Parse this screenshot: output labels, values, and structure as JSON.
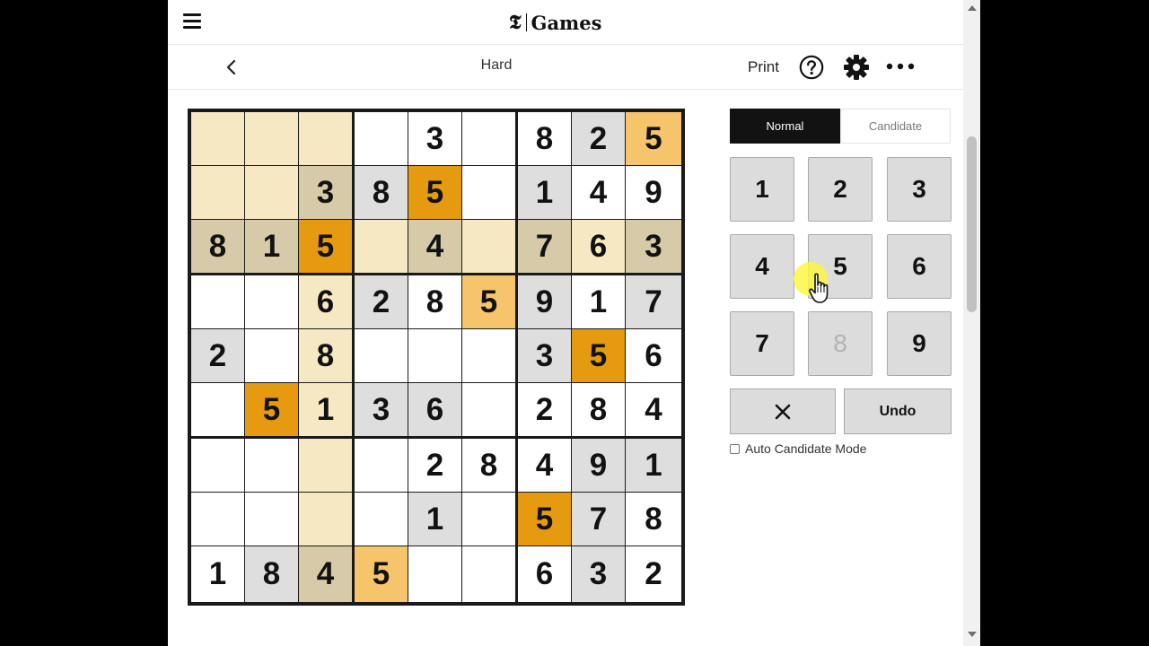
{
  "header": {
    "brand_mark": "𝕿",
    "brand_name": "Games"
  },
  "toolbar": {
    "difficulty": "Hard",
    "print_label": "Print"
  },
  "colors": {
    "row_col_box_highlight": "#f6e8c2",
    "given_cell": "#dedede",
    "given_in_highlight": "#d6caa9",
    "selected_number": "#e59a0f",
    "selected_number_in_highlight": "#f6c46b",
    "board_border": "#1a1a1a"
  },
  "grid": {
    "values": [
      [
        "",
        "",
        "",
        "",
        "3",
        "",
        "8",
        "2",
        "5"
      ],
      [
        "",
        "",
        "3",
        "8",
        "5",
        "",
        "1",
        "4",
        "9"
      ],
      [
        "8",
        "1",
        "5",
        "",
        "4",
        "",
        "7",
        "6",
        "3"
      ],
      [
        "",
        "",
        "6",
        "2",
        "8",
        "5",
        "9",
        "1",
        "7"
      ],
      [
        "2",
        "",
        "8",
        "",
        "",
        "",
        "3",
        "5",
        "6"
      ],
      [
        "",
        "5",
        "1",
        "3",
        "6",
        "",
        "2",
        "8",
        "4"
      ],
      [
        "",
        "",
        "",
        "",
        "2",
        "8",
        "4",
        "9",
        "1"
      ],
      [
        "",
        "",
        "",
        "",
        "1",
        "",
        "5",
        "7",
        "8"
      ],
      [
        "1",
        "8",
        "4",
        "5",
        "",
        "",
        "6",
        "3",
        "2"
      ]
    ],
    "states": [
      [
        "H",
        "H",
        "H",
        "W",
        "W",
        "W",
        "W",
        "G",
        "P"
      ],
      [
        "H",
        "H",
        "HG",
        "G",
        "O",
        "W",
        "G",
        "W",
        "W"
      ],
      [
        "HG",
        "HG",
        "O",
        "H",
        "HG",
        "H",
        "HG",
        "H",
        "HG"
      ],
      [
        "W",
        "W",
        "H",
        "G",
        "W",
        "P",
        "G",
        "W",
        "G"
      ],
      [
        "G",
        "W",
        "H",
        "W",
        "W",
        "W",
        "G",
        "O",
        "W"
      ],
      [
        "W",
        "O",
        "H",
        "G",
        "G",
        "W",
        "W",
        "W",
        "W"
      ],
      [
        "W",
        "W",
        "H",
        "W",
        "W",
        "W",
        "W",
        "G",
        "G"
      ],
      [
        "W",
        "W",
        "H",
        "W",
        "G",
        "W",
        "O",
        "G",
        "W"
      ],
      [
        "W",
        "G",
        "HG",
        "P",
        "W",
        "W",
        "W",
        "G",
        "W"
      ]
    ]
  },
  "mode_tabs": {
    "normal": "Normal",
    "candidate": "Candidate",
    "active": "Normal"
  },
  "keypad": {
    "numbers": [
      "1",
      "2",
      "3",
      "4",
      "5",
      "6",
      "7",
      "8",
      "9"
    ],
    "disabled": [
      "8"
    ],
    "erase_symbol": "✕",
    "undo_label": "Undo"
  },
  "auto_candidate": {
    "label": "Auto Candidate Mode",
    "checked": false
  }
}
